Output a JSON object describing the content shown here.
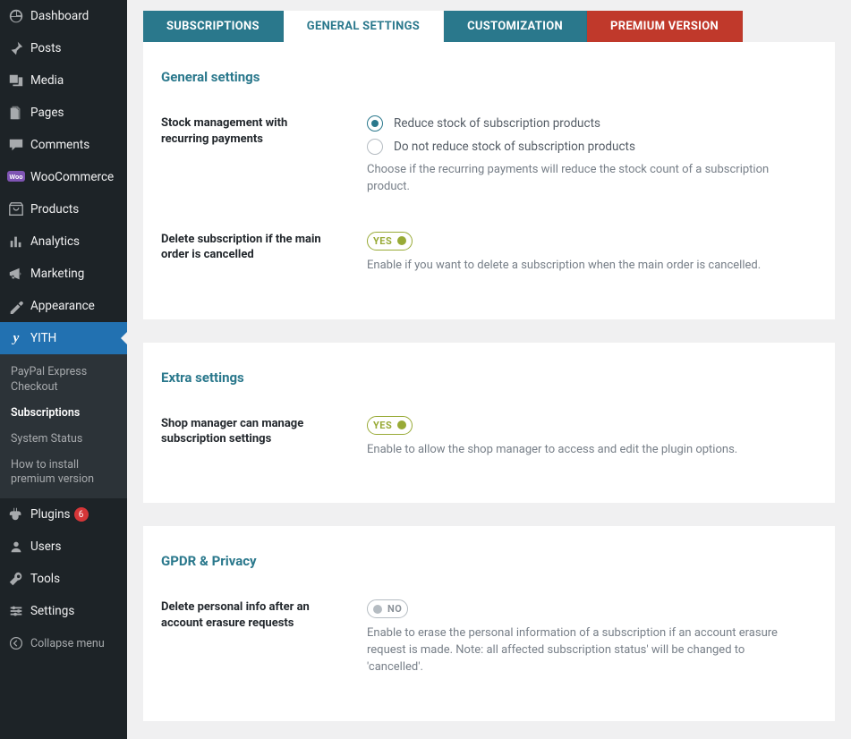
{
  "sidebar": {
    "items": [
      {
        "label": "Dashboard",
        "icon": "dashboard"
      },
      {
        "label": "Posts",
        "icon": "pin"
      },
      {
        "label": "Media",
        "icon": "media"
      },
      {
        "label": "Pages",
        "icon": "pages"
      },
      {
        "label": "Comments",
        "icon": "comments"
      },
      {
        "label": "WooCommerce",
        "icon": "woo"
      },
      {
        "label": "Products",
        "icon": "products"
      },
      {
        "label": "Analytics",
        "icon": "analytics"
      },
      {
        "label": "Marketing",
        "icon": "marketing"
      },
      {
        "label": "Appearance",
        "icon": "appearance"
      },
      {
        "label": "YITH",
        "icon": "yith",
        "active": true
      },
      {
        "label": "Plugins",
        "icon": "plugins",
        "badge": "6"
      },
      {
        "label": "Users",
        "icon": "users"
      },
      {
        "label": "Tools",
        "icon": "tools"
      },
      {
        "label": "Settings",
        "icon": "settings"
      }
    ],
    "submenu": [
      "PayPal Express Checkout",
      "Subscriptions",
      "System Status",
      "How to install premium version"
    ],
    "submenu_current": 1,
    "collapse": "Collapse menu"
  },
  "tabs": [
    "SUBSCRIPTIONS",
    "GENERAL SETTINGS",
    "CUSTOMIZATION",
    "PREMIUM VERSION"
  ],
  "active_tab": 1,
  "panels": {
    "general": {
      "title": "General settings",
      "stock": {
        "label": "Stock management with recurring payments",
        "opt1": "Reduce stock of subscription products",
        "opt2": "Do not reduce stock of subscription products",
        "help": "Choose if the recurring payments will reduce the stock count of a subscription product."
      },
      "delete": {
        "label": "Delete subscription if the main order is cancelled",
        "toggle": "YES",
        "help": "Enable if you want to delete a subscription when the main order is cancelled."
      }
    },
    "extra": {
      "title": "Extra settings",
      "manager": {
        "label": "Shop manager can manage subscription settings",
        "toggle": "YES",
        "help": "Enable to allow the shop manager to access and edit the plugin options."
      }
    },
    "gdpr": {
      "title": "GPDR & Privacy",
      "erase": {
        "label": "Delete personal info after an account erasure requests",
        "toggle": "NO",
        "help": "Enable to erase the personal information of a subscription if an account erasure request is made. Note: all affected subscription status' will be changed to 'cancelled'."
      }
    }
  }
}
